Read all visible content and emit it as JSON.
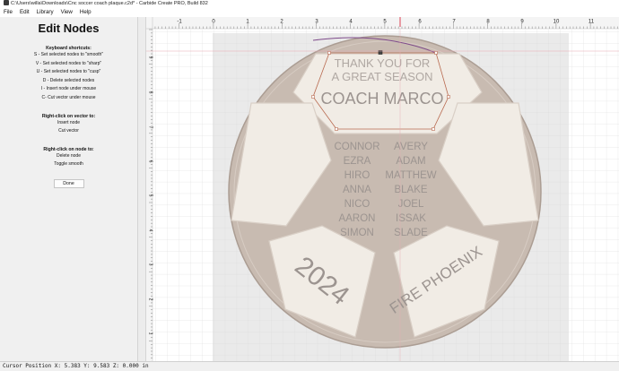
{
  "window": {
    "title": "C:\\Users\\willa\\Downloads\\Cnc soccer coach plaque.c2d* - Carbide Create PRO, Build 832"
  },
  "menu": [
    "File",
    "Edit",
    "Library",
    "View",
    "Help"
  ],
  "panel": {
    "title": "Edit Nodes",
    "shortcuts_title": "Keyboard shortcuts:",
    "shortcuts": [
      "S - Set selected nodes to \"smooth\"",
      "V - Set selected nodes to \"sharp\"",
      "U - Set selected nodes to \"cusp\"",
      "D - Delete selected nodes",
      "I - Insert node under mouse",
      "C- Cut vector under mouse"
    ],
    "vector_title": "Right-click on vector to:",
    "vector_actions": [
      "Insert node",
      "Cut vector"
    ],
    "node_title": "Right-click on node to:",
    "node_actions": [
      "Delete node",
      "Toggle smooth"
    ],
    "done_label": "Done"
  },
  "ruler": {
    "x_labels": [
      "-1",
      "0",
      "1",
      "2",
      "3",
      "4",
      "5",
      "6",
      "7",
      "8",
      "9",
      "10",
      "11"
    ],
    "y_labels": [
      "9",
      "8",
      "7",
      "6",
      "5",
      "4",
      "3",
      "2",
      "1"
    ]
  },
  "plaque": {
    "top_text_1": "THANK YOU FOR",
    "top_text_2": "A GREAT SEASON",
    "coach": "COACH MARCO",
    "names_left": [
      "CONNOR",
      "EZRA",
      "HIRO",
      "ANNA",
      "NICO",
      "AARON",
      "SIMON"
    ],
    "names_right": [
      "AVERY",
      "ADAM",
      "MATTHEW",
      "BLAKE",
      "JOEL",
      "ISSAK",
      "SLADE"
    ],
    "year": "2024",
    "team": "FIRE PHOENIX"
  },
  "status": {
    "text": "Cursor Position X: 5.383 Y: 9.583 Z: 0.000 in"
  },
  "colors": {
    "wood": "#c6b8ad",
    "panel_fill": "#f1ece5",
    "engrave": "#9c9490",
    "selection": "#b86a50",
    "cursor_line": "#e06070"
  }
}
